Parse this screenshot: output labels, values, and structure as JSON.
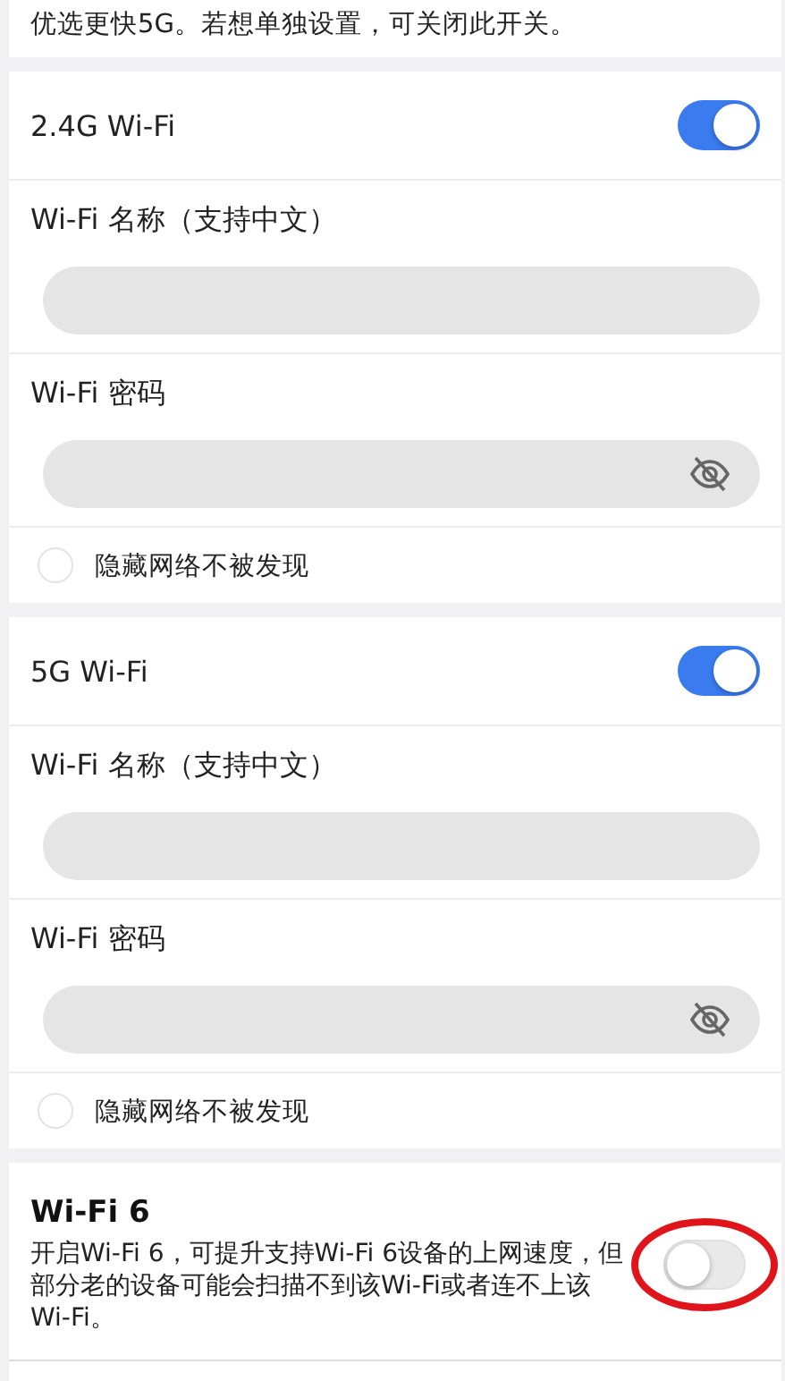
{
  "intro": {
    "text": "优选更快5G。若想单独设置，可关闭此开关。"
  },
  "bands": [
    {
      "title": "2.4G Wi-Fi",
      "on": true,
      "name_label": "Wi-Fi 名称（支持中文）",
      "password_label": "Wi-Fi 密码",
      "hidden_label": "隐藏网络不被发现",
      "hidden_checked": false
    },
    {
      "title": "5G Wi-Fi",
      "on": true,
      "name_label": "Wi-Fi 名称（支持中文）",
      "password_label": "Wi-Fi 密码",
      "hidden_label": "隐藏网络不被发现",
      "hidden_checked": false
    }
  ],
  "wifi6": {
    "title": "Wi-Fi 6",
    "description": "开启Wi-Fi 6，可提升支持Wi-Fi 6设备的上网速度，但部分老的设备可能会扫描不到该Wi-Fi或者连不上该Wi-Fi。",
    "on": false,
    "circled": true
  }
}
